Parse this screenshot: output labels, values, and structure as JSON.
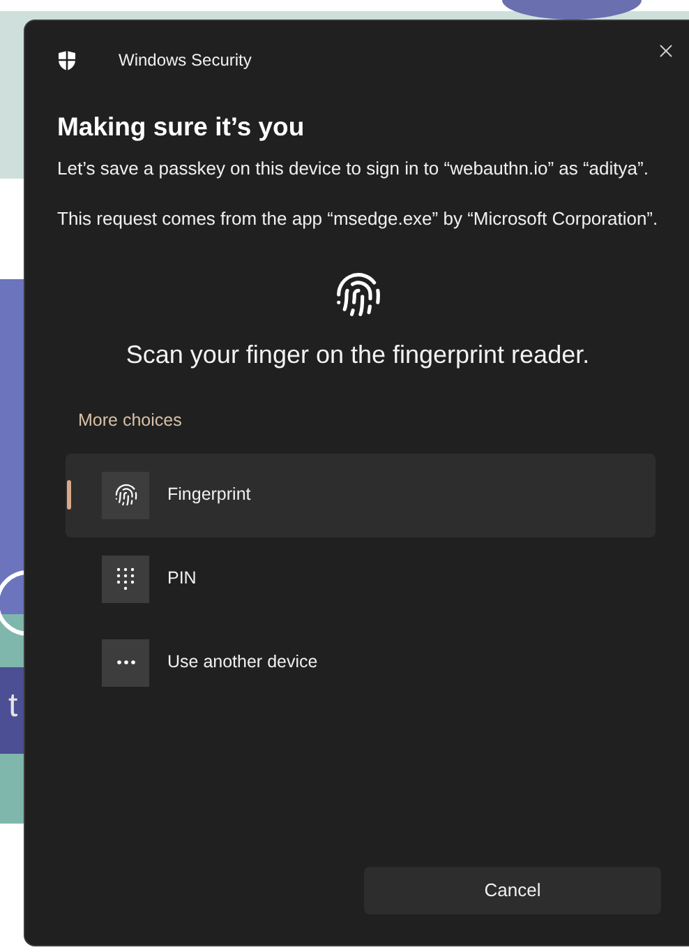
{
  "background": {
    "text_fragment": "t"
  },
  "dialog": {
    "app_name": "Windows Security",
    "title": "Making sure it’s you",
    "paragraphs": [
      "Let’s save a passkey on this device to sign in to “webauthn.io” as “aditya”.",
      "This request comes from the app “msedge.exe” by “Microsoft Corporation”."
    ],
    "prompt": "Scan your finger on the fingerprint reader.",
    "choices_label": "More choices",
    "choices": [
      {
        "kind": "fingerprint",
        "label": "Fingerprint",
        "selected": true
      },
      {
        "kind": "pin",
        "label": "PIN",
        "selected": false
      },
      {
        "kind": "device",
        "label": "Use another device",
        "selected": false
      }
    ],
    "cancel": "Cancel"
  }
}
